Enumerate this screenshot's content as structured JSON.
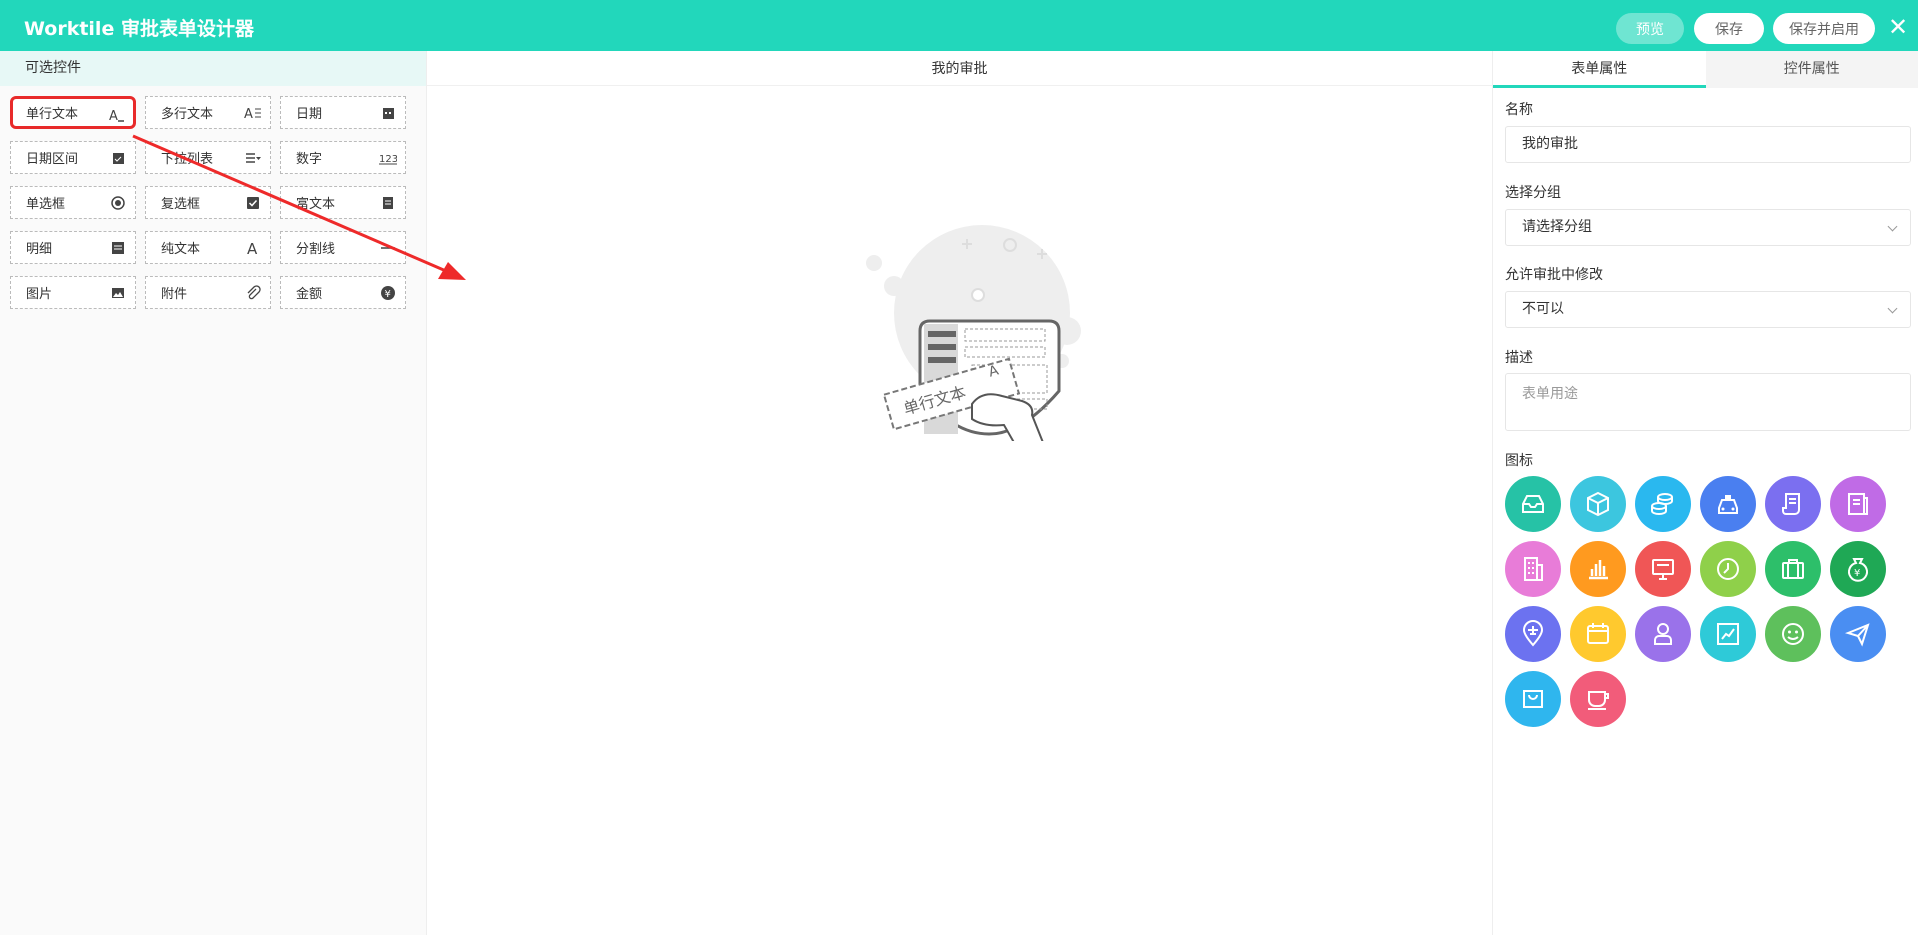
{
  "header": {
    "title": "Worktile 审批表单设计器",
    "preview_label": "预览",
    "save_label": "保存",
    "save_enable_label": "保存并启用",
    "close_symbol": "✕"
  },
  "palette": {
    "title": "可选控件",
    "controls": [
      {
        "label": "单行文本",
        "icon": "single-text-icon"
      },
      {
        "label": "多行文本",
        "icon": "multi-text-icon"
      },
      {
        "label": "日期",
        "icon": "calendar-icon"
      },
      {
        "label": "日期区间",
        "icon": "date-range-icon"
      },
      {
        "label": "下拉列表",
        "icon": "dropdown-icon"
      },
      {
        "label": "数字",
        "icon": "number-icon"
      },
      {
        "label": "单选框",
        "icon": "radio-icon"
      },
      {
        "label": "复选框",
        "icon": "checkbox-icon"
      },
      {
        "label": "富文本",
        "icon": "rich-text-icon"
      },
      {
        "label": "明细",
        "icon": "detail-icon"
      },
      {
        "label": "纯文本",
        "icon": "plain-text-icon"
      },
      {
        "label": "分割线",
        "icon": "divider-icon"
      },
      {
        "label": "图片",
        "icon": "image-icon"
      },
      {
        "label": "附件",
        "icon": "attachment-icon"
      },
      {
        "label": "金额",
        "icon": "currency-icon"
      }
    ]
  },
  "canvas": {
    "title": "我的审批",
    "illustration_label": "单行文本"
  },
  "properties": {
    "tabs": [
      "表单属性",
      "控件属性"
    ],
    "name_label": "名称",
    "name_value": "我的审批",
    "group_label": "选择分组",
    "group_value": "请选择分组",
    "modify_label": "允许审批中修改",
    "modify_value": "不可以",
    "desc_label": "描述",
    "desc_placeholder": "表单用途",
    "icon_label": "图标",
    "icons": [
      {
        "name": "inbox-icon",
        "color": "#26c2a6"
      },
      {
        "name": "cube-icon",
        "color": "#3cc6df"
      },
      {
        "name": "coins-icon",
        "color": "#2ab8ef"
      },
      {
        "name": "car-icon",
        "color": "#4a7ff0"
      },
      {
        "name": "receipt-icon",
        "color": "#7b6ff0"
      },
      {
        "name": "document-icon",
        "color": "#c06be6"
      },
      {
        "name": "building-icon",
        "color": "#e87cd8"
      },
      {
        "name": "bar-chart-icon",
        "color": "#ff9a1f"
      },
      {
        "name": "monitor-icon",
        "color": "#f05656"
      },
      {
        "name": "clock-icon",
        "color": "#8fd04a"
      },
      {
        "name": "briefcase-icon",
        "color": "#2dbf6a"
      },
      {
        "name": "money-bag-icon",
        "color": "#1fa855"
      },
      {
        "name": "location-plane-icon",
        "color": "#6c72f0"
      },
      {
        "name": "calendar-icon",
        "color": "#ffc92e"
      },
      {
        "name": "person-icon",
        "color": "#9a72ea"
      },
      {
        "name": "line-chart-icon",
        "color": "#2ecad8"
      },
      {
        "name": "smile-icon",
        "color": "#5ec05c"
      },
      {
        "name": "paper-plane-icon",
        "color": "#4a8ef2"
      },
      {
        "name": "shopping-bag-icon",
        "color": "#2fb6ee"
      },
      {
        "name": "coffee-cup-icon",
        "color": "#f25c7a"
      }
    ]
  }
}
